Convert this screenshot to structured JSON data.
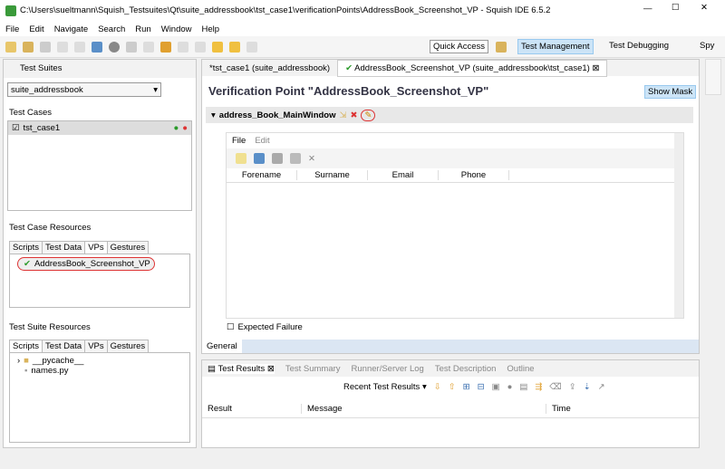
{
  "window": {
    "title": "C:\\Users\\sueltmann\\Squish_Testsuites\\Qt\\suite_addressbook\\tst_case1\\verificationPoints\\AddressBook_Screenshot_VP - Squish IDE 6.5.2"
  },
  "menu": [
    "File",
    "Edit",
    "Navigate",
    "Search",
    "Run",
    "Window",
    "Help"
  ],
  "toolbar": {
    "quick_access": "Quick Access",
    "perspectives": [
      "Test Management",
      "Test Debugging",
      "Spy"
    ]
  },
  "left": {
    "suites_title": "Test Suites",
    "suite_select": "suite_addressbook",
    "test_cases_label": "Test Cases",
    "test_case": "tst_case1",
    "resources_label": "Test Case Resources",
    "resource_tabs": [
      "Scripts",
      "Test Data",
      "VPs",
      "Gestures"
    ],
    "vp_item": "AddressBook_Screenshot_VP",
    "suite_resources_label": "Test Suite Resources",
    "suite_tabs": [
      "Scripts",
      "Test Data",
      "VPs",
      "Gestures"
    ],
    "files": [
      "__pycache__",
      "names.py"
    ]
  },
  "editor": {
    "tabs": [
      "*tst_case1 (suite_addressbook)",
      "AddressBook_Screenshot_VP (suite_addressbook\\tst_case1)"
    ],
    "title": "Verification Point \"AddressBook_Screenshot_VP\"",
    "show_mask": "Show Mask",
    "section": "address_Book_MainWindow",
    "app_menu": [
      "File",
      "Edit"
    ],
    "columns": [
      "Forename",
      "Surname",
      "Email",
      "Phone"
    ],
    "expected_failure": "Expected Failure",
    "bottom_tab": "General"
  },
  "bottom": {
    "tabs": [
      "Test Results",
      "Test Summary",
      "Runner/Server Log",
      "Test Description",
      "Outline"
    ],
    "recent": "Recent Test Results",
    "columns": [
      "Result",
      "Message",
      "Time"
    ]
  }
}
